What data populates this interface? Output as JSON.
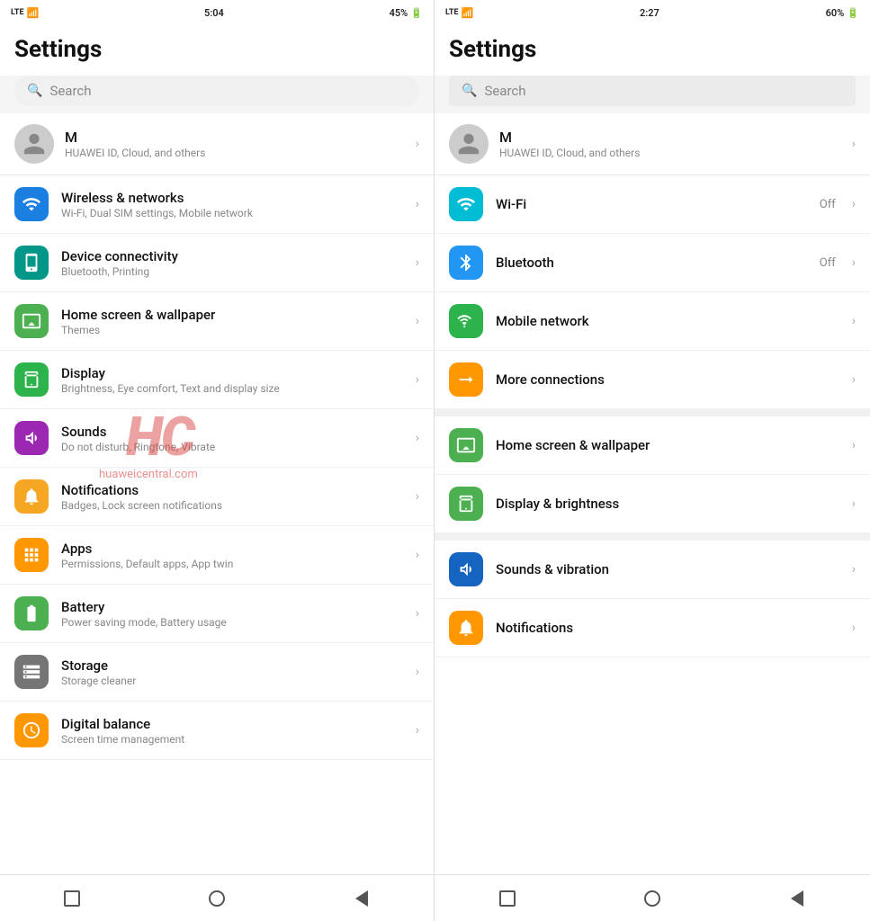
{
  "left": {
    "status": {
      "network": "LTE 4G",
      "signal": "▌▌▌▌",
      "battery": "45%",
      "time": "5:04"
    },
    "title": "Settings",
    "search": {
      "placeholder": "Search"
    },
    "profile": {
      "initial": "M",
      "name": "M",
      "subtitle": "HUAWEI ID, Cloud, and others"
    },
    "items": [
      {
        "icon": "wifi",
        "iconColor": "ic-blue",
        "title": "Wireless & networks",
        "subtitle": "Wi-Fi, Dual SIM settings, Mobile network"
      },
      {
        "icon": "device",
        "iconColor": "ic-teal",
        "title": "Device connectivity",
        "subtitle": "Bluetooth, Printing"
      },
      {
        "icon": "homescreen",
        "iconColor": "ic-green-light",
        "title": "Home screen & wallpaper",
        "subtitle": "Themes"
      },
      {
        "icon": "display",
        "iconColor": "ic-green2",
        "title": "Display",
        "subtitle": "Brightness, Eye comfort, Text and display size"
      },
      {
        "icon": "sounds",
        "iconColor": "ic-purple",
        "title": "Sounds",
        "subtitle": "Do not disturb, Ringtone, Vibrate"
      },
      {
        "icon": "notifications",
        "iconColor": "ic-yellow",
        "title": "Notifications",
        "subtitle": "Badges, Lock screen notifications"
      },
      {
        "icon": "apps",
        "iconColor": "ic-orange",
        "title": "Apps",
        "subtitle": "Permissions, Default apps, App twin"
      },
      {
        "icon": "battery",
        "iconColor": "ic-green3",
        "title": "Battery",
        "subtitle": "Power saving mode, Battery usage"
      },
      {
        "icon": "storage",
        "iconColor": "ic-gray",
        "title": "Storage",
        "subtitle": "Storage cleaner"
      },
      {
        "icon": "digital",
        "iconColor": "ic-orange2",
        "title": "Digital balance",
        "subtitle": "Screen time management"
      }
    ]
  },
  "right": {
    "status": {
      "network": "LTE 4G",
      "signal": "▌▌▌▌",
      "battery": "60%",
      "time": "2:27"
    },
    "title": "Settings",
    "search": {
      "placeholder": "Search"
    },
    "profile": {
      "initial": "M",
      "name": "M",
      "subtitle": "HUAWEI ID, Cloud, and others"
    },
    "items": [
      {
        "icon": "wifi",
        "iconColor": "ic-cyan",
        "title": "Wi-Fi",
        "status": "Off",
        "group": 1
      },
      {
        "icon": "bluetooth",
        "iconColor": "ic-blue3",
        "title": "Bluetooth",
        "status": "Off",
        "group": 1
      },
      {
        "icon": "mobile",
        "iconColor": "ic-green2",
        "title": "Mobile network",
        "status": "",
        "group": 1
      },
      {
        "icon": "more",
        "iconColor": "ic-orange",
        "title": "More connections",
        "status": "",
        "group": 1
      },
      {
        "icon": "homescreen",
        "iconColor": "ic-green3",
        "title": "Home screen & wallpaper",
        "status": "",
        "group": 2
      },
      {
        "icon": "display",
        "iconColor": "ic-green3",
        "title": "Display & brightness",
        "status": "",
        "group": 2
      },
      {
        "icon": "sounds",
        "iconColor": "ic-blue2",
        "title": "Sounds & vibration",
        "status": "",
        "group": 3
      },
      {
        "icon": "notifications",
        "iconColor": "ic-orange2",
        "title": "Notifications",
        "status": "",
        "group": 3
      }
    ]
  },
  "watermark": "HC",
  "watermark_url": "huaweicentral.com"
}
